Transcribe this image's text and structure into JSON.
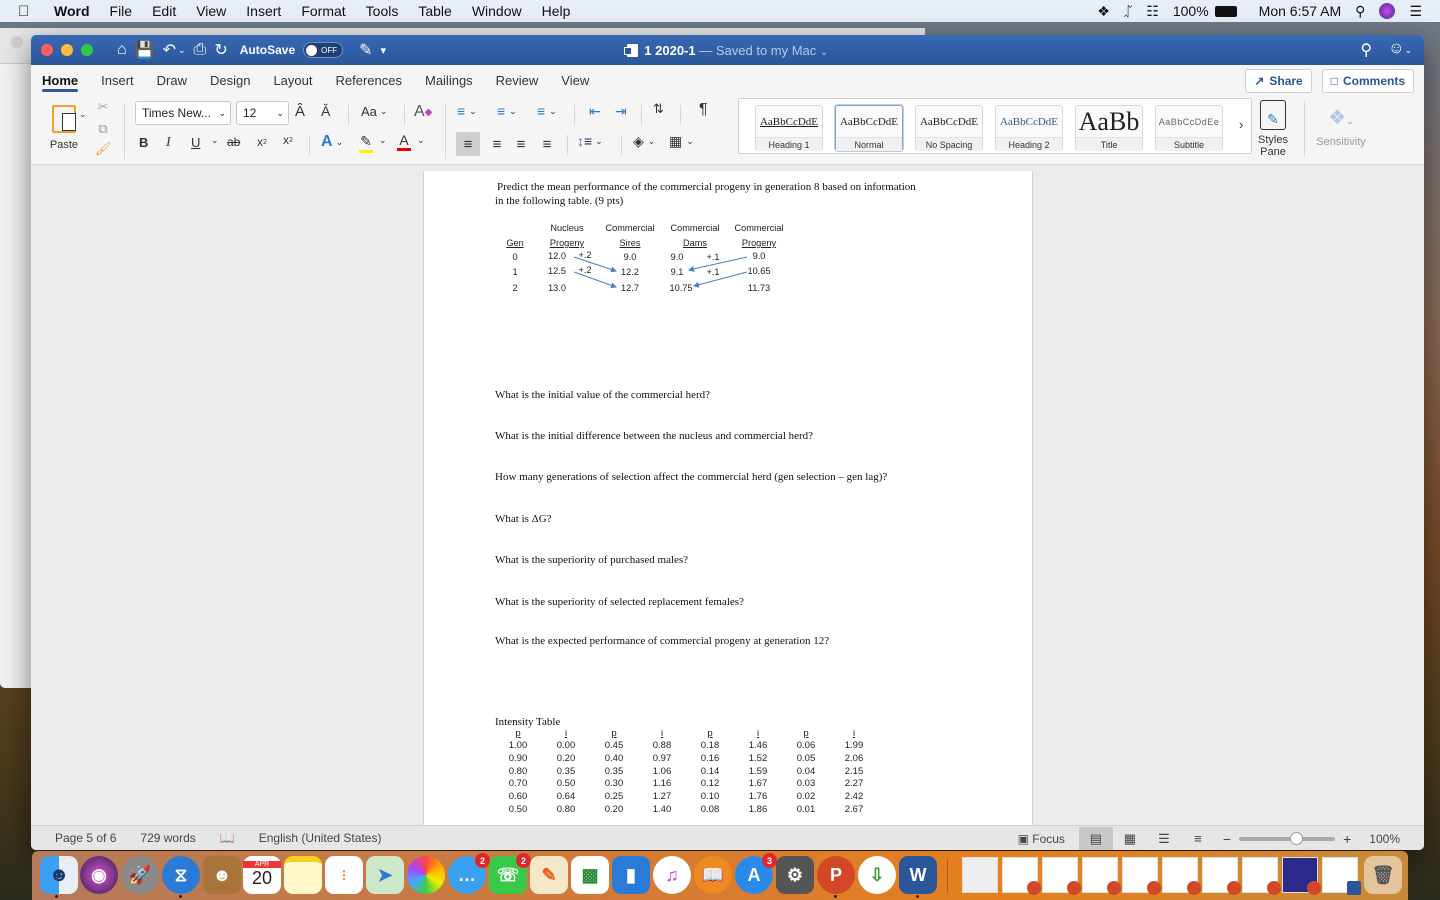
{
  "menubar": {
    "app": "Word",
    "items": [
      "File",
      "Edit",
      "View",
      "Insert",
      "Format",
      "Tools",
      "Table",
      "Window",
      "Help"
    ],
    "battery": "100%",
    "clock": "Mon 6:57 AM"
  },
  "titlebar": {
    "autosave_label": "AutoSave",
    "autosave_state": "OFF",
    "doc_name": "1 2020-1",
    "doc_status": "— Saved to my Mac"
  },
  "tabs": [
    "Home",
    "Insert",
    "Draw",
    "Design",
    "Layout",
    "References",
    "Mailings",
    "Review",
    "View"
  ],
  "active_tab": "Home",
  "share_label": "Share",
  "comments_label": "Comments",
  "ribbon": {
    "paste_label": "Paste",
    "font_name": "Times New...",
    "font_size": "12",
    "change_case": "Aa",
    "styles": [
      {
        "preview": "AaBbCcDdE",
        "label": "Heading 1"
      },
      {
        "preview": "AaBbCcDdE",
        "label": "Normal"
      },
      {
        "preview": "AaBbCcDdE",
        "label": "No Spacing"
      },
      {
        "preview": "AaBbCcDdE",
        "label": "Heading 2"
      },
      {
        "preview": "AaBb",
        "label": "Title"
      },
      {
        "preview": "AaBbCcDdEe",
        "label": "Subtitle"
      }
    ],
    "selected_style": "Normal",
    "styles_pane_label": "Styles Pane",
    "styles_pane_l1": "Styles",
    "styles_pane_l2": "Pane",
    "sensitivity_label": "Sensitivity"
  },
  "document": {
    "intro_line1": "Predict the mean performance of the commercial progeny in generation 8 based on information",
    "intro_line2": "in the following table.  (9 pts)",
    "gen_table": {
      "header_top": [
        "",
        "Nucleus",
        "Commercial",
        "Commercial",
        "Commercial"
      ],
      "header_bottom": [
        "Gen",
        "Progeny",
        "Sires",
        "Dams",
        "Progeny"
      ],
      "rows": [
        {
          "gen": "0",
          "nucleus": "12.0",
          "sires": "9.0",
          "dams": "9.0",
          "progeny": "9.0"
        },
        {
          "gen": "1",
          "nucleus": "12.5",
          "sires": "12.2",
          "dams": "9.1",
          "progeny": "10.65"
        },
        {
          "gen": "2",
          "nucleus": "13.0",
          "sires": "12.7",
          "dams": "10.75",
          "progeny": "11.73"
        }
      ],
      "annotations": {
        "nucleus_gain_0": "+.2",
        "nucleus_gain_1": "+.2",
        "dams_gain_0": "+.1",
        "dams_gain_1": "+.1"
      }
    },
    "questions": [
      "What is the initial value of the commercial herd?",
      "What is the initial difference between the nucleus and commercial herd?",
      "How many generations of selection affect the commercial herd (gen selection – gen lag)?",
      "What is ΔG?",
      "What is the superiority of purchased males?",
      "What is the superiority of selected replacement females?",
      "What is the expected performance of commercial progeny at generation 12?"
    ],
    "intensity_title": "Intensity Table",
    "intensity_headers": [
      "p",
      "i",
      "p",
      "i",
      "p",
      "i",
      "p",
      "i"
    ],
    "intensity_columns": [
      [
        "1.00",
        "0.90",
        "0.80",
        "0.70",
        "0.60",
        "0.50"
      ],
      [
        "0.00",
        "0.20",
        "0.35",
        "0.50",
        "0.64",
        "0.80"
      ],
      [
        "0.45",
        "0.40",
        "0.35",
        "0.30",
        "0.25",
        "0.20"
      ],
      [
        "0.88",
        "0.97",
        "1.06",
        "1.16",
        "1.27",
        "1.40"
      ],
      [
        "0.18",
        "0.16",
        "0.14",
        "0.12",
        "0.10",
        "0.08"
      ],
      [
        "1.46",
        "1.52",
        "1.59",
        "1.67",
        "1.76",
        "1.86"
      ],
      [
        "0.06",
        "0.05",
        "0.04",
        "0.03",
        "0.02",
        "0.01"
      ],
      [
        "1.99",
        "2.06",
        "2.15",
        "2.27",
        "2.42",
        "2.67"
      ]
    ]
  },
  "statusbar": {
    "page": "Page 5 of 6",
    "words": "729 words",
    "language": "English (United States)",
    "focus": "Focus",
    "zoom": "100%",
    "zoom_value": 100
  },
  "dock": {
    "calendar_month": "APR",
    "calendar_day": "20",
    "messages_badge": "2",
    "facetime_badge": "2",
    "appstore_badge": "3"
  }
}
